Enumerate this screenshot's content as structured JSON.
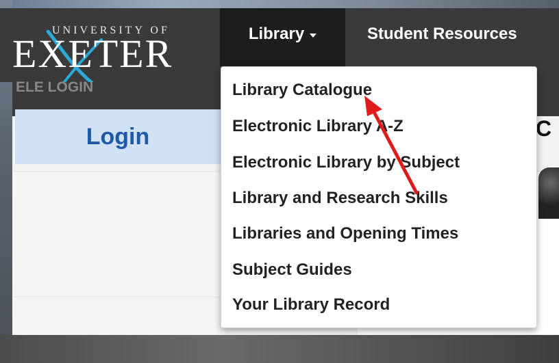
{
  "brand": {
    "university_of": "UNIVERSITY OF",
    "exeter": "EXETER"
  },
  "nav": {
    "library": "Library",
    "student_resources": "Student Resources"
  },
  "dropdown": {
    "items": [
      "Library Catalogue",
      "Electronic Library A-Z",
      "Electronic Library by Subject",
      "Library and Research Skills",
      "Libraries and Opening Times",
      "Subject Guides",
      "Your Library Record"
    ]
  },
  "sidebar": {
    "ele_login": "ELE LOGIN",
    "login_button": "Login"
  },
  "main": {
    "heading_fragment": "C"
  },
  "colors": {
    "header": "#3a3a3a",
    "nav_active": "#1d1d1d",
    "login_bg": "#cfe1f2",
    "login_text": "#1f5aa6",
    "annotation_arrow": "#e01b1b",
    "logo_swoosh": "#2aa9d6"
  },
  "icons": {
    "caret": "chevron-down-icon",
    "annotation": "red-arrow-annotation"
  }
}
